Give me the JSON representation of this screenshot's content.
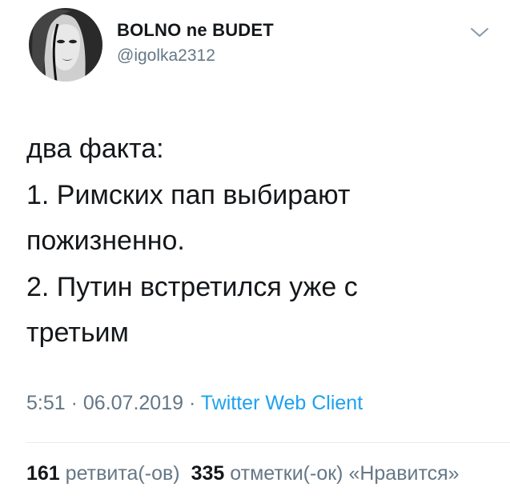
{
  "user": {
    "display_name": "BOLNO ne BUDET",
    "handle": "@igolka2312"
  },
  "tweet": {
    "text": "два факта:\n1. Римских пап выбирают\nпожизненно.\n2. Путин встретился уже с\nтретьим",
    "time": "5:51",
    "separator1": " · ",
    "date": "06.07.2019",
    "separator2": " · ",
    "source": "Twitter Web Client"
  },
  "stats": {
    "retweets_count": "161",
    "retweets_label": "ретвита(-ов)",
    "likes_count": "335",
    "likes_label": "отметки(-ок) «Нравится»"
  },
  "icons": {
    "avatar": "profile-photo",
    "caret": "chevron-down-icon"
  },
  "colors": {
    "text": "#14171a",
    "secondary": "#657786",
    "link": "#1da1f2"
  }
}
